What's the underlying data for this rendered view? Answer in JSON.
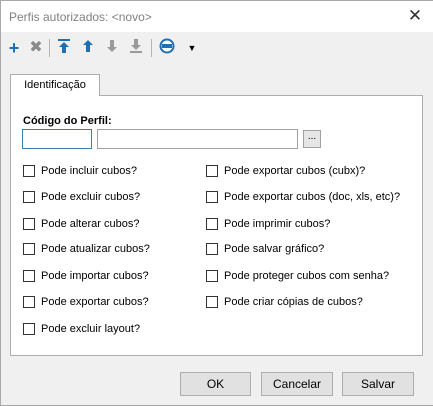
{
  "window": {
    "title": "Perfis autorizados: <novo>"
  },
  "toolbar": {
    "icons": [
      "plus-icon",
      "delete-icon",
      "move-top-icon",
      "move-up-icon",
      "move-down-icon",
      "move-bottom-icon",
      "grid-icon",
      "dropdown-arrow-icon"
    ]
  },
  "tab": {
    "label": "Identificação"
  },
  "form": {
    "code_label": "Código do Perfil:",
    "code_value": "",
    "name_value": "",
    "browse_label": "..."
  },
  "checkboxes": {
    "left": [
      {
        "label": "Pode incluir cubos?",
        "checked": false
      },
      {
        "label": "Pode excluir cubos?",
        "checked": false
      },
      {
        "label": "Pode alterar cubos?",
        "checked": false
      },
      {
        "label": "Pode atualizar cubos?",
        "checked": false
      },
      {
        "label": "Pode importar cubos?",
        "checked": false
      },
      {
        "label": "Pode exportar cubos?",
        "checked": false
      },
      {
        "label": "Pode excluir layout?",
        "checked": false
      }
    ],
    "right": [
      {
        "label": "Pode exportar cubos (cubx)?",
        "checked": false
      },
      {
        "label": "Pode exportar cubos (doc, xls, etc)?",
        "checked": false
      },
      {
        "label": "Pode imprimir cubos?",
        "checked": false
      },
      {
        "label": "Pode salvar gráfico?",
        "checked": false
      },
      {
        "label": "Pode proteger cubos com senha?",
        "checked": false
      },
      {
        "label": "Pode criar cópias de cubos?",
        "checked": false
      }
    ]
  },
  "buttons": {
    "ok": "OK",
    "cancel": "Cancelar",
    "save": "Salvar"
  },
  "colors": {
    "accent": "#1f6fb2",
    "focus_border": "#3c7fb1"
  }
}
